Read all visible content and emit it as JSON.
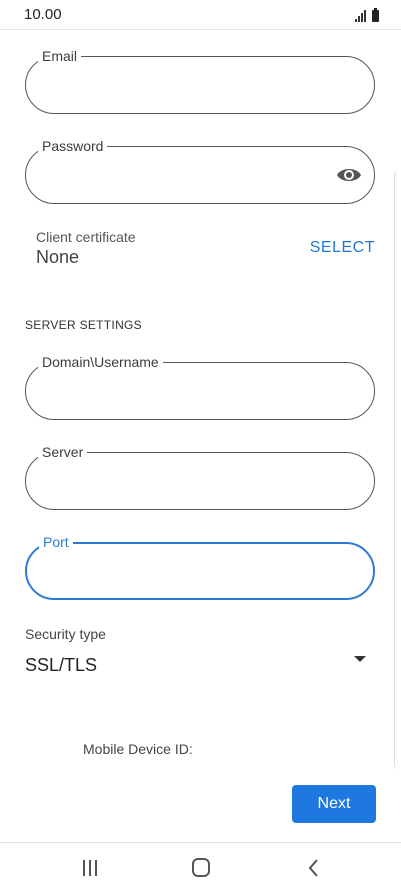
{
  "status_bar": {
    "time": "10.00"
  },
  "fields": {
    "email": {
      "label": "Email",
      "value": ""
    },
    "password": {
      "label": "Password",
      "value": ""
    },
    "domain_username": {
      "label": "Domain\\Username",
      "value": ""
    },
    "server": {
      "label": "Server",
      "value": ""
    },
    "port": {
      "label": "Port",
      "value": ""
    }
  },
  "certificate": {
    "label": "Client certificate",
    "value": "None",
    "action_label": "SELECT"
  },
  "server_settings": {
    "title": "SERVER SETTINGS"
  },
  "security": {
    "label": "Security type",
    "value": "SSL/TLS"
  },
  "device": {
    "label": "Mobile Device ID:"
  },
  "actions": {
    "next_label": "Next"
  },
  "icons": {
    "password_toggle": "eye-icon",
    "nav_recents": "recent-apps-icon",
    "nav_home": "home-icon",
    "nav_back": "back-icon"
  },
  "colors": {
    "accent": "#1e78e0",
    "focused_border": "#2d7ad6",
    "link": "#1f78d1"
  }
}
